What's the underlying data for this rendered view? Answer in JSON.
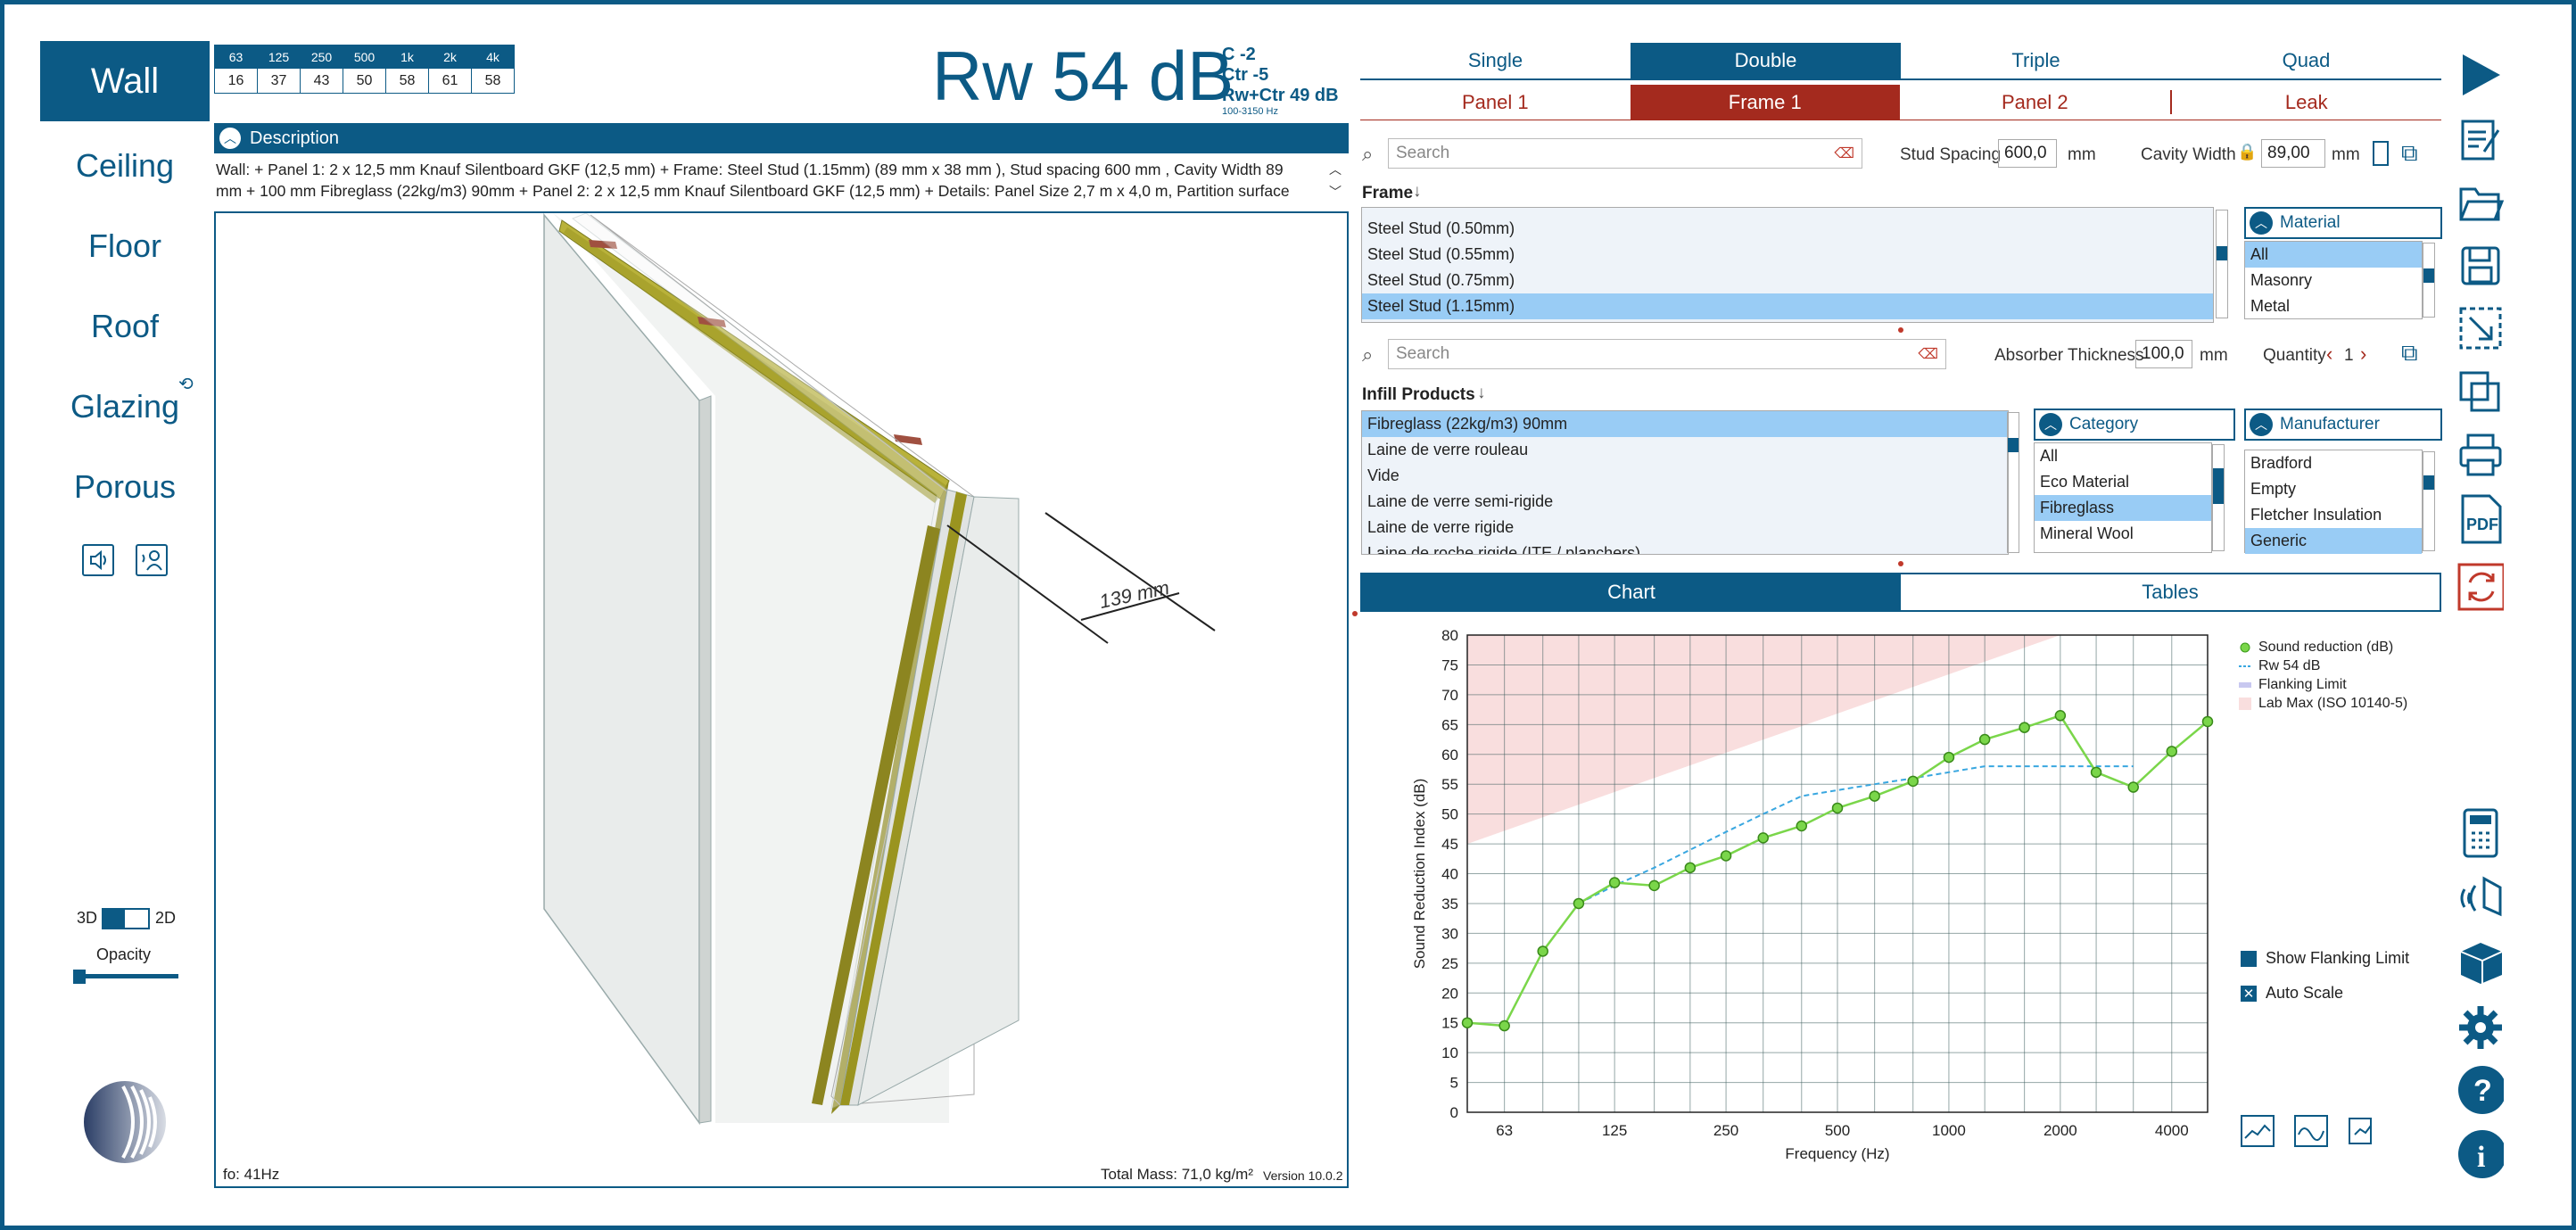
{
  "nav": {
    "items": [
      "Wall",
      "Ceiling",
      "Floor",
      "Roof",
      "Glazing",
      "Porous"
    ],
    "mode_3d": "3D",
    "mode_2d": "2D",
    "opacity_label": "Opacity"
  },
  "freq": {
    "headers": [
      "63",
      "125",
      "250",
      "500",
      "1k",
      "2k",
      "4k"
    ],
    "values": [
      "16",
      "37",
      "43",
      "50",
      "58",
      "61",
      "58"
    ]
  },
  "rating": {
    "main": "Rw 54 dB",
    "c": "C -2",
    "ctr": "Ctr -5",
    "rwctr": "Rw+Ctr 49 dB",
    "range": "100-3150 Hz"
  },
  "description": {
    "title": "Description",
    "text": "Wall:  + Panel 1: 2 x 12,5 mm Knauf Silentboard GKF (12,5 mm) + Frame: Steel Stud (1.15mm) (89 mm x 38 mm ), Stud spacing  600 mm , Cavity Width 89 mm  + 100 mm  Fibreglass (22kg/m3) 90mm + Panel 2: 2 x 12,5 mm Knauf Silentboard GKF (12,5 mm) + Details: Panel Size  2,7 m x 4,0 m, Partition surface"
  },
  "view": {
    "dimension": "139 mm",
    "fo": "fo: 41Hz",
    "mass": "Total Mass: 71,0 kg/m²",
    "version": "Version 10.0.2"
  },
  "type_tabs": [
    "Single",
    "Double",
    "Triple",
    "Quad"
  ],
  "part_tabs": [
    "Panel 1",
    "Frame 1",
    "Panel 2",
    "Leak"
  ],
  "frame": {
    "search_placeholder": "Search",
    "stud_spacing_label": "Stud Spacing",
    "stud_spacing": "600,0",
    "unit": "mm",
    "cavity_label": "Cavity Width",
    "cavity": "89,00",
    "list_title": "Frame",
    "items": [
      "Steel Stud (0.50mm)",
      "Steel Stud (0.55mm)",
      "Steel Stud (0.75mm)",
      "Steel Stud (1.15mm)"
    ],
    "material_title": "Material",
    "materials": [
      "All",
      "Masonry",
      "Metal"
    ]
  },
  "infill": {
    "search_placeholder": "Search",
    "absorber_label": "Absorber Thickness",
    "absorber": "100,0",
    "unit": "mm",
    "quantity_label": "Quantity",
    "quantity": "1",
    "list_title": "Infill Products",
    "items": [
      "Fibreglass (22kg/m3) 90mm",
      "Laine de verre rouleau",
      "Vide",
      "Laine de verre semi-rigide",
      "Laine de verre rigide",
      "Laine de roche rigide (ITE / planchers)"
    ],
    "category_title": "Category",
    "categories": [
      "All",
      "Eco Material",
      "Fibreglass",
      "Mineral Wool"
    ],
    "manufacturer_title": "Manufacturer",
    "manufacturers": [
      "Bradford",
      "Empty",
      "Fletcher Insulation",
      "Generic"
    ]
  },
  "result_tabs": [
    "Chart",
    "Tables"
  ],
  "chart_opts": {
    "flanking": "Show Flanking Limit",
    "autoscale": "Auto Scale"
  },
  "chart_data": {
    "type": "line",
    "xlabel": "Frequency (Hz)",
    "ylabel": "Sound Reduction Index (dB)",
    "xticks": [
      "63",
      "125",
      "250",
      "500",
      "1000",
      "2000",
      "4000"
    ],
    "ylim": [
      0,
      80
    ],
    "yticks": [
      0,
      5,
      10,
      15,
      20,
      25,
      30,
      35,
      40,
      45,
      50,
      55,
      60,
      65,
      70,
      75,
      80
    ],
    "x": [
      50,
      63,
      80,
      100,
      125,
      160,
      200,
      250,
      315,
      400,
      500,
      630,
      800,
      1000,
      1250,
      1600,
      2000,
      2500,
      3150,
      4000,
      5000
    ],
    "series": [
      {
        "name": "Sound reduction (dB)",
        "color": "#7ad64a",
        "values": [
          15,
          14.5,
          27,
          35,
          38.5,
          38,
          41,
          43,
          46,
          48,
          51,
          53,
          55.5,
          59.5,
          62.5,
          64.5,
          66.5,
          57,
          54.5,
          60.5,
          65.5
        ]
      },
      {
        "name": "Rw 54 dB",
        "color": "#39a7e0",
        "dashed": true,
        "x": [
          100,
          125,
          160,
          200,
          250,
          315,
          400,
          500,
          630,
          800,
          1000,
          1250,
          1600,
          2000,
          2500,
          3150
        ],
        "values": [
          35,
          38,
          41,
          44,
          47,
          50,
          53,
          54,
          55,
          56,
          57,
          58,
          58,
          58,
          58,
          58
        ]
      }
    ],
    "legend": [
      "Sound reduction (dB)",
      "Rw 54 dB",
      "Flanking Limit",
      "Lab Max (ISO 10140-5)"
    ],
    "legend_colors": [
      "#7ad64a",
      "#39a7e0",
      "#c8c8f0",
      "#f9dede"
    ],
    "lab_max": {
      "x": [
        50,
        2000
      ],
      "low": [
        45,
        80
      ]
    },
    "grid": true
  }
}
